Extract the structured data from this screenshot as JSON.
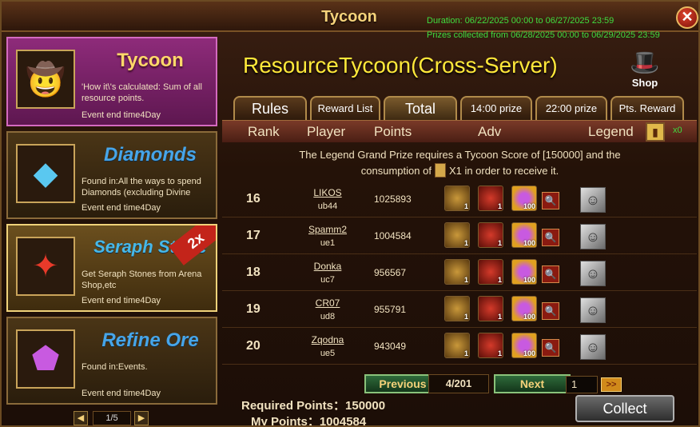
{
  "window": {
    "title": "Tycoon",
    "duration": "Duration: 06/22/2025 00:00 to 06/27/2025 23:59",
    "prizes_collected": "Prizes collected from 06/28/2025 00:00 to 06/29/2025 23:59"
  },
  "events": [
    {
      "name": "Tycoon",
      "desc": "'How it\\'s calculated: Sum of all resource points.",
      "end": "Event end time4Day",
      "icon": "tycoon-portrait-icon"
    },
    {
      "name": "Diamonds",
      "desc": "Found in:All the ways to spend Diamonds (excluding Divine",
      "end": "Event end time4Day",
      "icon": "diamond-icon"
    },
    {
      "name": "Seraph Stone",
      "desc": "Get Seraph Stones from Arena Shop,etc",
      "end": "Event end time4Day",
      "badge": "2x",
      "icon": "seraph-stone-icon"
    },
    {
      "name": "Refine Ore",
      "desc": "Found in:Events.",
      "end": "Event end time4Day",
      "icon": "refine-ore-icon"
    }
  ],
  "left_pager": {
    "text": "1/5"
  },
  "main": {
    "title": "ResourceTycoon(Cross-Server)",
    "shop_label": "Shop",
    "tabs": [
      "Rules",
      "Reward List",
      "Total",
      "14:00 prize",
      "22:00 prize",
      "Pts. Reward"
    ],
    "active_tab": "Total",
    "headers": {
      "rank": "Rank",
      "player": "Player",
      "points": "Points",
      "adv": "Adv",
      "legend": "Legend",
      "legend_count": "x0"
    },
    "notice_line1": "The Legend Grand Prize requires a Tycoon Score of [150000] and the",
    "notice_line2a": "consumption of",
    "notice_line2b": "X1 in order to receive it."
  },
  "rows": [
    {
      "rank": "16",
      "player": "LIKOS",
      "server": "ub44",
      "points": "1025893",
      "items": [
        "1",
        "1",
        "100"
      ]
    },
    {
      "rank": "17",
      "player": "Spamm2",
      "server": "ue1",
      "points": "1004584",
      "items": [
        "1",
        "1",
        "100"
      ]
    },
    {
      "rank": "18",
      "player": "Donka",
      "server": "uc7",
      "points": "956567",
      "items": [
        "1",
        "1",
        "100"
      ]
    },
    {
      "rank": "19",
      "player": "CR07",
      "server": "ud8",
      "points": "955791",
      "items": [
        "1",
        "1",
        "100"
      ]
    },
    {
      "rank": "20",
      "player": "Zqodna",
      "server": "ue5",
      "points": "943049",
      "items": [
        "1",
        "1",
        "100"
      ]
    }
  ],
  "pager": {
    "prev": "Previous",
    "page": "4/201",
    "next": "Next",
    "input": "1",
    "go": ">>"
  },
  "footer": {
    "required": "Required Points：150000",
    "mine": "My Points：1004584",
    "collect": "Collect"
  }
}
